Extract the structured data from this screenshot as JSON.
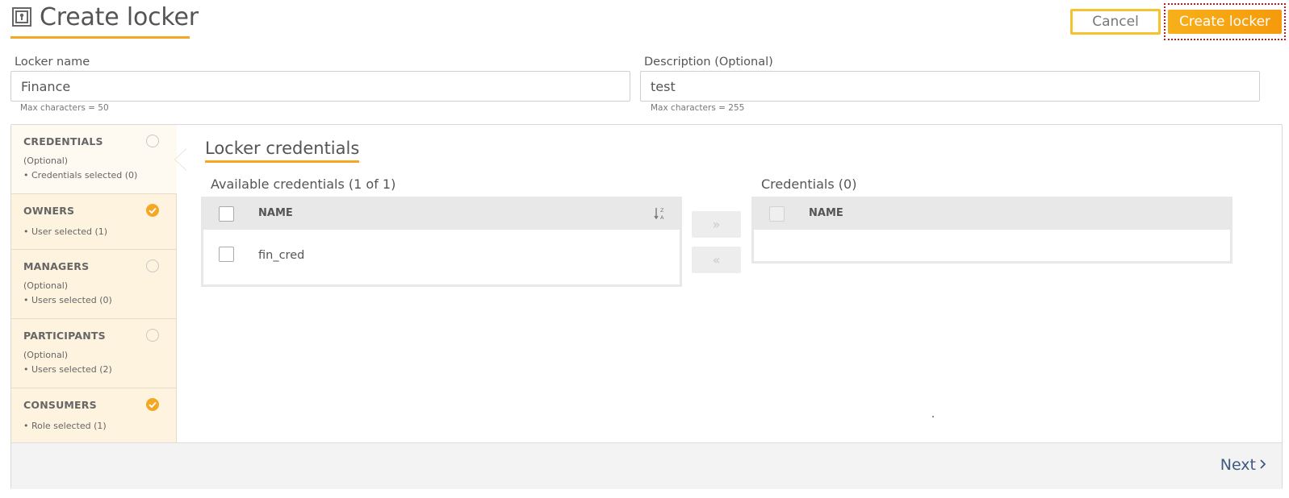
{
  "header": {
    "icon": "locker-icon",
    "title": "Create locker",
    "cancel_label": "Cancel",
    "create_label": "Create locker"
  },
  "form": {
    "locker_name": {
      "label": "Locker name",
      "value": "Finance",
      "hint": "Max characters = 50"
    },
    "description": {
      "label": "Description (Optional)",
      "value": "test",
      "hint": "Max characters = 255"
    }
  },
  "sidebar": {
    "items": [
      {
        "title": "CREDENTIALS",
        "optional": "(Optional)",
        "summary": "• Credentials selected (0)",
        "status": "pending",
        "active": true
      },
      {
        "title": "OWNERS",
        "optional": "",
        "summary": "• User selected (1)",
        "status": "done",
        "active": false
      },
      {
        "title": "MANAGERS",
        "optional": "(Optional)",
        "summary": "• Users selected (0)",
        "status": "pending",
        "active": false
      },
      {
        "title": "PARTICIPANTS",
        "optional": "(Optional)",
        "summary": "• Users selected (2)",
        "status": "pending",
        "active": false
      },
      {
        "title": "CONSUMERS",
        "optional": "",
        "summary": "• Role selected (1)",
        "status": "done",
        "active": false
      }
    ]
  },
  "main": {
    "section_title": "Locker credentials",
    "available": {
      "label": "Available credentials (1 of 1)",
      "column": "NAME",
      "sort_icon": "sort-alpha-icon",
      "rows": [
        {
          "name": "fin_cred"
        }
      ]
    },
    "selected": {
      "label": "Credentials (0)",
      "column": "NAME",
      "rows": []
    },
    "move_right": "»",
    "move_left": "«"
  },
  "footer": {
    "next_label": "Next",
    "next_icon": "chevron-right-icon"
  },
  "colors": {
    "accent": "#f5a623",
    "next_link": "#3d5a80",
    "sidebar_bg": "#fdf3df"
  }
}
